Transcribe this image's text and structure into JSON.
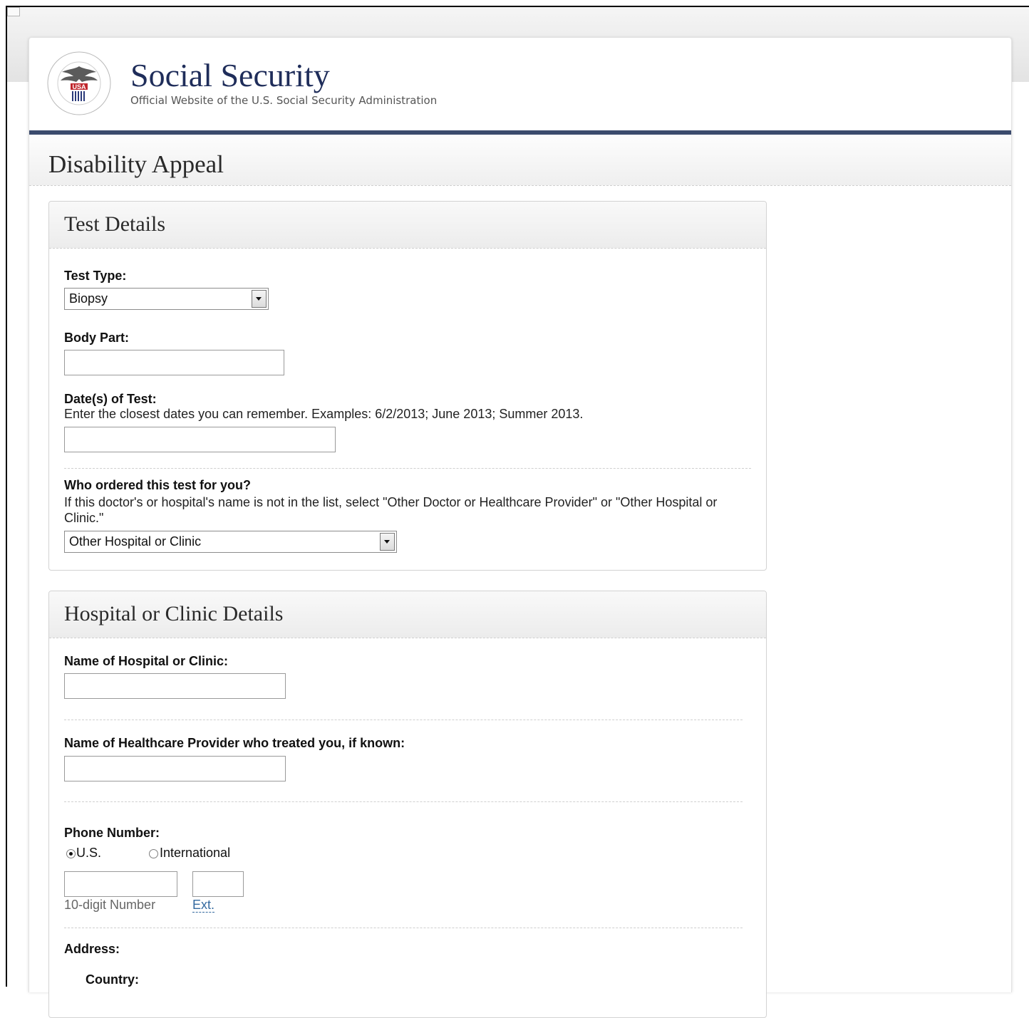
{
  "site": {
    "title": "Social Security",
    "subtitle": "Official Website of the U.S. Social Security Administration",
    "seal_text": "USA"
  },
  "page_title": "Disability Appeal",
  "test_details": {
    "heading": "Test Details",
    "test_type_label": "Test Type:",
    "test_type_value": "Biopsy",
    "body_part_label": "Body Part:",
    "dates_label": "Date(s) of Test:",
    "dates_help": "Enter the closest dates you can remember. Examples: 6/2/2013; June 2013; Summer 2013.",
    "ordered_label": "Who ordered this test for you?",
    "ordered_help": "If this doctor's or hospital's name is not in the list, select \"Other Doctor or Healthcare Provider\" or \"Other Hospital or Clinic.\"",
    "ordered_value": "Other Hospital or Clinic"
  },
  "hospital_details": {
    "heading": "Hospital or Clinic Details",
    "name_label": "Name of Hospital or Clinic:",
    "provider_label": "Name of Healthcare Provider who treated you, if known:",
    "phone_label": "Phone Number:",
    "phone_options": [
      "U.S.",
      "International"
    ],
    "phone_selected": "U.S.",
    "phone_number_hint": "10-digit Number",
    "phone_ext_hint": "Ext.",
    "address_label": "Address:",
    "country_label": "Country:"
  }
}
